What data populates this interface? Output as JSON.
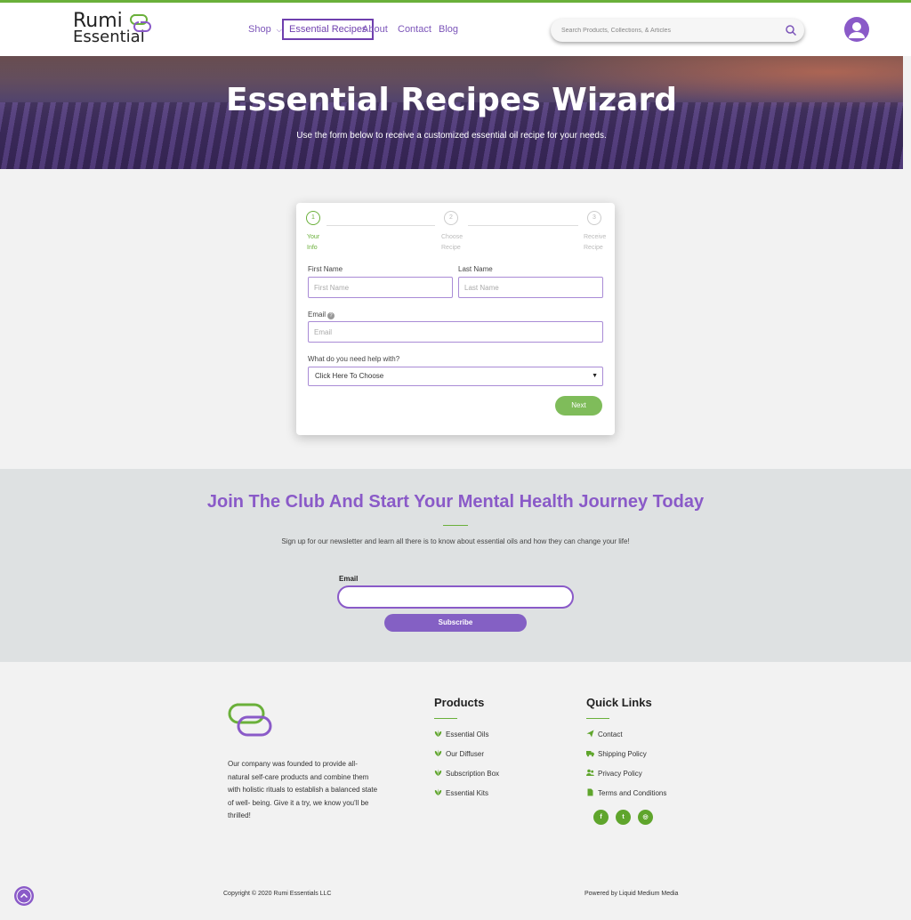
{
  "brand": {
    "logo_line1": "Rumi",
    "logo_line2": "Essential",
    "accent_purple": "#8a5ac8",
    "accent_green": "#6ab03a"
  },
  "nav": {
    "shop": "Shop",
    "essential_recipes": "Essential Recipes",
    "about": "About",
    "contact": "Contact",
    "blog": "Blog"
  },
  "search": {
    "placeholder": "Search Products, Collections, & Articles",
    "icon": "search-icon"
  },
  "hero": {
    "title": "Essential Recipes Wizard",
    "subtitle": "Use the form below to receive a customized essential oil recipe for your needs."
  },
  "wizard": {
    "steps": [
      {
        "number": "1",
        "label_l1": "Your",
        "label_l2": "Info"
      },
      {
        "number": "2",
        "label_l1": "Choose",
        "label_l2": "Recipe"
      },
      {
        "number": "3",
        "label_l1": "Receive",
        "label_l2": "Recipe"
      }
    ],
    "first_name_label": "First Name",
    "first_name_placeholder": "First Name",
    "last_name_label": "Last Name",
    "last_name_placeholder": "Last Name",
    "email_label": "Email",
    "email_placeholder": "Email",
    "help_label": "What do you need help with?",
    "help_selected": "Click Here To Choose",
    "next_label": "Next"
  },
  "club": {
    "title": "Join The Club And Start Your Mental Health Journey Today",
    "subtitle": "Sign up for our newsletter and learn all there is to know about essential oils and how they can change your life!",
    "email_label": "Email",
    "subscribe_label": "Subscribe"
  },
  "footer": {
    "about": "Our company was founded to provide all-natural self-care products and combine them with holistic rituals to establish a balanced state of well- being. Give it a try, we know you'll be thrilled!",
    "products_title": "Products",
    "products": [
      "Essential Oils",
      "Our Diffuser",
      "Subscription Box",
      "Essential Kits"
    ],
    "quick_links_title": "Quick Links",
    "quick_links": [
      {
        "label": "Contact",
        "icon": "paper-plane-icon"
      },
      {
        "label": "Shipping Policy",
        "icon": "truck-icon"
      },
      {
        "label": "Privacy Policy",
        "icon": "users-icon"
      },
      {
        "label": "Terms and Conditions",
        "icon": "document-icon"
      }
    ],
    "social": [
      {
        "glyph": "f",
        "icon": "facebook-icon"
      },
      {
        "glyph": "t",
        "icon": "twitter-icon"
      },
      {
        "glyph": "◎",
        "icon": "instagram-icon"
      }
    ],
    "copyright": "Copyright © 2020 Rumi Essentials LLC",
    "powered_by": "Powered by Liquid Medium Media"
  }
}
